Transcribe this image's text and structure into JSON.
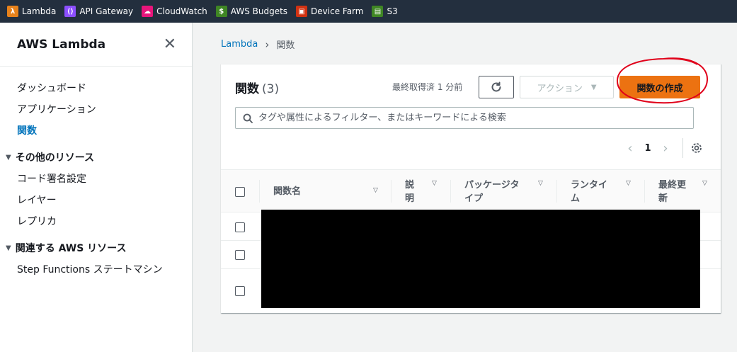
{
  "favorites": [
    {
      "label": "Lambda",
      "icon": "lambda-icon",
      "color": "#e7821b"
    },
    {
      "label": "API Gateway",
      "icon": "api-gateway-icon",
      "color": "#8c4fff"
    },
    {
      "label": "CloudWatch",
      "icon": "cloudwatch-icon",
      "color": "#e7157b"
    },
    {
      "label": "AWS Budgets",
      "icon": "budgets-icon",
      "color": "#3f8624"
    },
    {
      "label": "Device Farm",
      "icon": "device-farm-icon",
      "color": "#d13212"
    },
    {
      "label": "S3",
      "icon": "s3-icon",
      "color": "#3f8624"
    }
  ],
  "sidebar": {
    "title": "AWS Lambda",
    "items": [
      {
        "label": "ダッシュボード"
      },
      {
        "label": "アプリケーション"
      },
      {
        "label": "関数",
        "active": true
      }
    ],
    "other_section": "その他のリソース",
    "other_items": [
      {
        "label": "コード署名設定"
      },
      {
        "label": "レイヤー"
      },
      {
        "label": "レプリカ"
      }
    ],
    "related_section": "関連する AWS リソース",
    "related_items": [
      {
        "label": "Step Functions ステートマシン"
      }
    ]
  },
  "breadcrumb": {
    "root": "Lambda",
    "current": "関数"
  },
  "functions_panel": {
    "title": "関数",
    "count": "(3)",
    "last_fetched": "最終取得済 1 分前",
    "actions_label": "アクション",
    "create_label": "関数の作成",
    "search_placeholder": "タグや属性によるフィルター、またはキーワードによる検索",
    "page": "1",
    "columns": [
      "関数名",
      "説明",
      "パッケージタイプ",
      "ランタイム",
      "最終更新"
    ],
    "rows": 3
  },
  "colors": {
    "topbar": "#232f3e",
    "link": "#0073bb",
    "primary_button": "#ec7211",
    "annotation": "#e0001a"
  }
}
